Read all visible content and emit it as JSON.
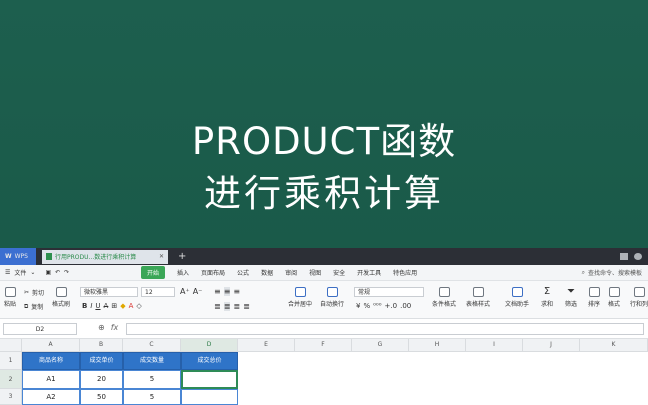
{
  "video_title": {
    "line1": "PRODUCT函数",
    "line2": "进行乘积计算"
  },
  "tabs": {
    "app": "WPS",
    "doc": "行用PRODU...数进行乘积计算",
    "new_tab": "+"
  },
  "menu": {
    "file": "文件",
    "items": [
      "开始",
      "插入",
      "页面布局",
      "公式",
      "数据",
      "审阅",
      "视图",
      "安全",
      "开发工具",
      "特色应用"
    ],
    "active_index": 0,
    "search": "查找命令、搜索模板"
  },
  "toolbar": {
    "paste": "粘贴",
    "cut": "剪切",
    "copy": "复制",
    "format_painter": "格式刷",
    "font_name": "微软雅黑",
    "font_size": "12",
    "merge_center": "合并居中",
    "wrap_text": "自动换行",
    "number_format": "常规",
    "conditional_format": "条件格式",
    "table_style": "表格样式",
    "doc_helper": "文档助手",
    "sum": "求和",
    "filter": "筛选",
    "sort": "排序",
    "format": "格式",
    "rows_cols": "行和列"
  },
  "formula_bar": {
    "name_box": "D2",
    "fx": "fx"
  },
  "grid": {
    "columns": [
      "A",
      "B",
      "C",
      "D",
      "E",
      "F",
      "G",
      "H",
      "I",
      "J",
      "K"
    ],
    "rows": [
      "1",
      "2",
      "3"
    ],
    "cells": [
      [
        "商品名称",
        "成交单价",
        "成交数量",
        "成交总价"
      ],
      [
        "A1",
        "20",
        "5",
        ""
      ],
      [
        "A2",
        "50",
        "5",
        ""
      ]
    ],
    "header_color": "#2f74c8"
  },
  "colors": {
    "background": "#1c5d4c",
    "accent": "#3aa657"
  }
}
